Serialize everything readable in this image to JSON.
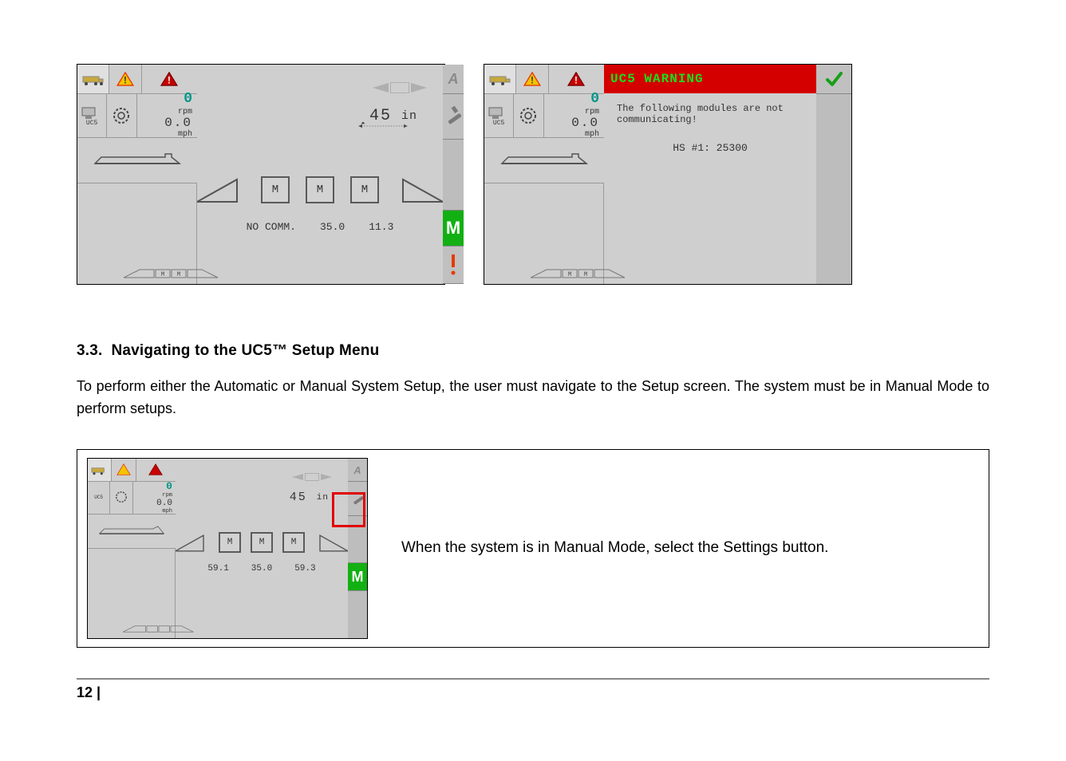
{
  "figure1": {
    "rpm_value": "0",
    "rpm_label": "rpm",
    "speed_value": "0.0",
    "speed_unit": "mph",
    "uc5_label": "UC5",
    "reading_value": "45",
    "reading_unit": "in",
    "m_labels": [
      "M",
      "M",
      "M"
    ],
    "values": [
      "NO COMM.",
      "35.0",
      "11.3"
    ],
    "mode_button": "M"
  },
  "figure2": {
    "rpm_value": "0",
    "rpm_label": "rpm",
    "speed_value": "0.0",
    "speed_unit": "mph",
    "uc5_label": "UC5",
    "banner": "UC5 WARNING",
    "message_line1": "The following modules are not",
    "message_line2": "communicating!",
    "module": "HS #1: 25300"
  },
  "section": {
    "number": "3.3.",
    "title": "Navigating to the UC5™ Setup Menu"
  },
  "paragraph": "To perform either the Automatic or Manual System Setup, the user must navigate to the Setup screen. The system must be in Manual Mode to perform setups.",
  "instruction": {
    "rpm_value": "0",
    "rpm_label": "rpm",
    "speed_value": "0.0",
    "speed_unit": "mph",
    "uc5_label": "UC5",
    "reading_value": "45",
    "reading_unit": "in",
    "m_labels": [
      "M",
      "M",
      "M"
    ],
    "values": [
      "59.1",
      "35.0",
      "59.3"
    ],
    "mode_button": "M",
    "description": "When the system is in Manual Mode, select the Settings button."
  },
  "page_number": "12 |"
}
